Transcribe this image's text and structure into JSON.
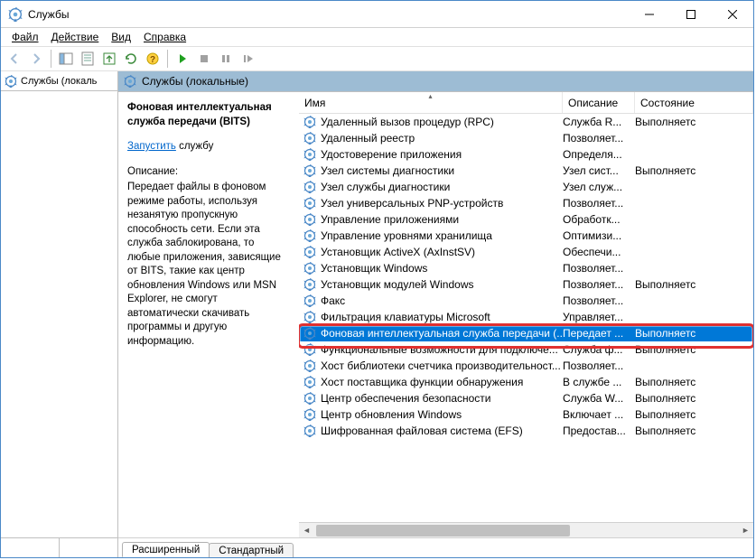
{
  "window": {
    "title": "Службы"
  },
  "menu": {
    "file": "Файл",
    "action": "Действие",
    "view": "Вид",
    "help": "Справка"
  },
  "tree": {
    "root": "Службы (локаль"
  },
  "detail": {
    "header": "Службы (локальные)",
    "info": {
      "name": "Фоновая интеллектуальная служба передачи (BITS)",
      "action_link": "Запустить",
      "action_suffix": " службу",
      "desc_label": "Описание:",
      "desc_text": "Передает файлы в фоновом режиме работы, используя незанятую пропускную способность сети. Если эта служба заблокирована, то любые приложения, зависящие от BITS, такие как центр обновления Windows или MSN Explorer, не смогут автоматически скачивать программы и другую информацию."
    }
  },
  "columns": {
    "name": "Имя",
    "desc": "Описание",
    "state": "Состояние"
  },
  "services": [
    {
      "name": "Удаленный вызов процедур (RPC)",
      "desc": "Служба R...",
      "state": "Выполняетс"
    },
    {
      "name": "Удаленный реестр",
      "desc": "Позволяет...",
      "state": ""
    },
    {
      "name": "Удостоверение приложения",
      "desc": "Определя...",
      "state": ""
    },
    {
      "name": "Узел системы диагностики",
      "desc": "Узел сист...",
      "state": "Выполняетс"
    },
    {
      "name": "Узел службы диагностики",
      "desc": "Узел служ...",
      "state": ""
    },
    {
      "name": "Узел универсальных PNP-устройств",
      "desc": "Позволяет...",
      "state": ""
    },
    {
      "name": "Управление приложениями",
      "desc": "Обработк...",
      "state": ""
    },
    {
      "name": "Управление уровнями хранилища",
      "desc": "Оптимизи...",
      "state": ""
    },
    {
      "name": "Установщик ActiveX (AxInstSV)",
      "desc": "Обеспечи...",
      "state": ""
    },
    {
      "name": "Установщик Windows",
      "desc": "Позволяет...",
      "state": ""
    },
    {
      "name": "Установщик модулей Windows",
      "desc": "Позволяет...",
      "state": "Выполняетс"
    },
    {
      "name": "Факс",
      "desc": "Позволяет...",
      "state": ""
    },
    {
      "name": "Фильтрация клавиатуры Microsoft",
      "desc": "Управляет...",
      "state": ""
    },
    {
      "name": "Фоновая интеллектуальная служба передачи (...",
      "desc": "Передает ...",
      "state": "Выполняетс",
      "selected": true
    },
    {
      "name": "Функциональные возможности для подключе...",
      "desc": "Служба ф...",
      "state": "Выполняетс"
    },
    {
      "name": "Хост библиотеки счетчика производительност...",
      "desc": "Позволяет...",
      "state": ""
    },
    {
      "name": "Хост поставщика функции обнаружения",
      "desc": "В службе ...",
      "state": "Выполняетс"
    },
    {
      "name": "Центр обеспечения безопасности",
      "desc": "Служба W...",
      "state": "Выполняетс"
    },
    {
      "name": "Центр обновления Windows",
      "desc": "Включает ...",
      "state": "Выполняетс"
    },
    {
      "name": "Шифрованная файловая система (EFS)",
      "desc": "Предостав...",
      "state": "Выполняетс"
    }
  ],
  "tabs": {
    "ext": "Расширенный",
    "std": "Стандартный"
  }
}
